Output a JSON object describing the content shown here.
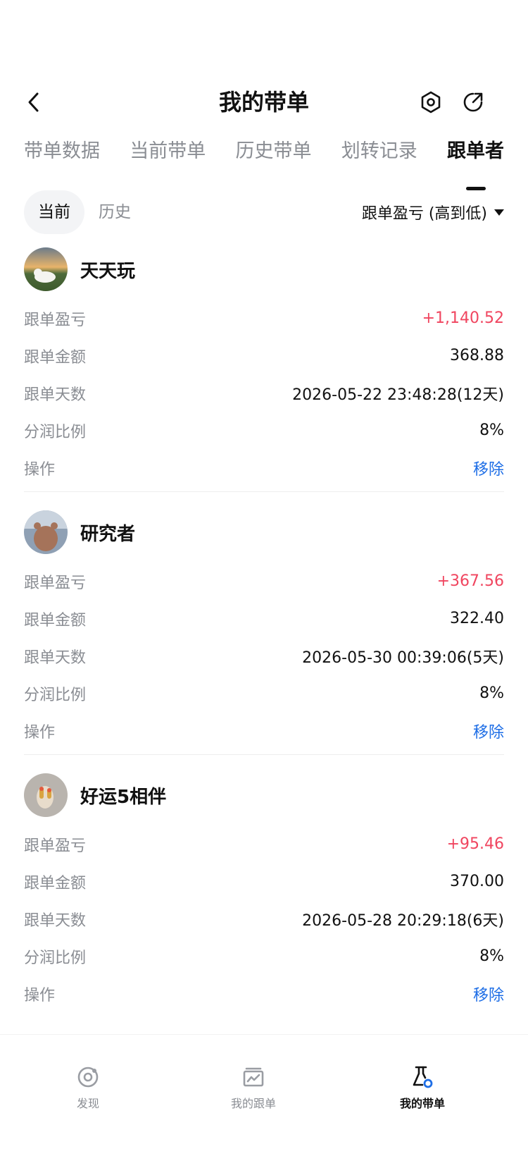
{
  "header": {
    "title": "我的带单"
  },
  "tabs": [
    "带单数据",
    "当前带单",
    "历史带单",
    "划转记录",
    "跟单者"
  ],
  "active_tab": 4,
  "filter": {
    "segments": [
      "当前",
      "历史"
    ],
    "active_segment": 0,
    "sort_label": "跟单盈亏 (高到低)"
  },
  "followers": [
    {
      "name": "天天玩",
      "rows": [
        {
          "label": "跟单盈亏",
          "value": "+1,140.52"
        },
        {
          "label": "跟单金额",
          "value": "368.88"
        },
        {
          "label": "跟单天数",
          "value": "2026-05-22 23:48:28(12天)"
        },
        {
          "label": "分润比例",
          "value": "8%"
        },
        {
          "label": "操作",
          "value": "移除"
        }
      ]
    },
    {
      "name": "研究者",
      "rows": [
        {
          "label": "跟单盈亏",
          "value": "+367.56"
        },
        {
          "label": "跟单金额",
          "value": "322.40"
        },
        {
          "label": "跟单天数",
          "value": "2026-05-30 00:39:06(5天)"
        },
        {
          "label": "分润比例",
          "value": "8%"
        },
        {
          "label": "操作",
          "value": "移除"
        }
      ]
    },
    {
      "name": "好运5相伴",
      "rows": [
        {
          "label": "跟单盈亏",
          "value": "+95.46"
        },
        {
          "label": "跟单金额",
          "value": "370.00"
        },
        {
          "label": "跟单天数",
          "value": "2026-05-28 20:29:18(6天)"
        },
        {
          "label": "分润比例",
          "value": "8%"
        },
        {
          "label": "操作",
          "value": "移除"
        }
      ]
    }
  ],
  "bottom_nav": [
    {
      "label": "发现",
      "icon": "discover-icon"
    },
    {
      "label": "我的跟单",
      "icon": "chart-icon"
    },
    {
      "label": "我的带单",
      "icon": "flask-icon"
    }
  ],
  "colors": {
    "profit": "#f0455f",
    "action": "#1e6ee6",
    "muted": "#8a8d93",
    "text": "#111111"
  }
}
